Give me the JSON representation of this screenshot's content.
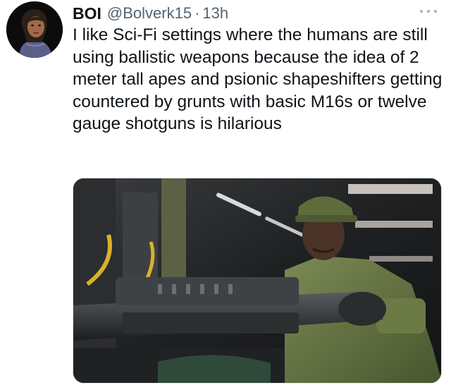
{
  "tweet": {
    "author": {
      "display_name": "BOI",
      "handle": "@Bolverk15",
      "separator": "·",
      "timestamp": "13h"
    },
    "text": "I like Sci-Fi settings where the humans are still using ballistic weapons because the idea of 2 meter tall apes and psionic shapeshifters getting countered by grunts with basic M16s or twelve gauge shotguns is hilarious",
    "icons": {
      "avatar": "avatar-illustration",
      "more": "more-options-icon"
    },
    "colors": {
      "text_primary": "#0f1419",
      "text_secondary": "#536471",
      "armor_green": "#5a6b3a",
      "yellow_pipe": "#d9b22a"
    }
  }
}
